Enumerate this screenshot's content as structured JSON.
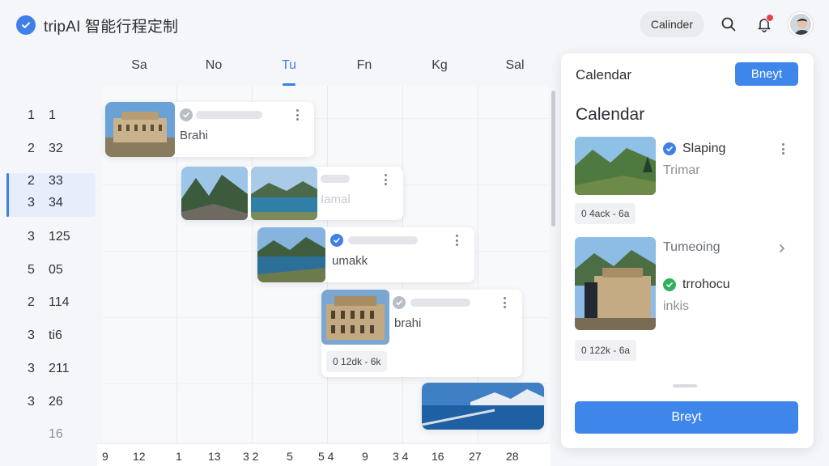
{
  "header": {
    "title": "tripAI 智能行程定制",
    "calendar_button": "Calinder"
  },
  "days": [
    "Sa",
    "No",
    "Tu",
    "Fn",
    "Kg",
    "Sal"
  ],
  "active_day": "Tu",
  "time_rows": [
    {
      "a": "1",
      "b": "1"
    },
    {
      "a": "2",
      "b": "32"
    },
    {
      "a": "2",
      "b": "33"
    },
    {
      "a": "3",
      "b": "34"
    },
    {
      "a": "3",
      "b": "125"
    },
    {
      "a": "5",
      "b": "05"
    },
    {
      "a": "2",
      "b": "114"
    },
    {
      "a": "3",
      "b": "ti6"
    },
    {
      "a": "3",
      "b": "211"
    },
    {
      "a": "3",
      "b": "26"
    },
    {
      "a": "",
      "b": "16"
    }
  ],
  "bottom_ticks": [
    "9",
    "12",
    "1",
    "13",
    "3 2",
    "5",
    "5 4",
    "9",
    "3 4",
    "16",
    "27",
    "28"
  ],
  "events": {
    "e1": {
      "title": "Brahi"
    },
    "e2": {
      "title": "Iamal"
    },
    "e3": {
      "title": "umakk"
    },
    "e4": {
      "title": "brahi",
      "tag": "0 12dk - 6k"
    }
  },
  "panel": {
    "title": "Calendar",
    "top_button": "Bneyt",
    "heading": "Calendar",
    "item1": {
      "title": "Slaping",
      "subtitle": "Trimar",
      "tag": "0 4ack - 6a"
    },
    "item2": {
      "header": "Tumeoing",
      "title": "trrohocu",
      "subtitle": "inkis",
      "tag": "0 122k - 6a"
    },
    "main_button": "Breyt"
  },
  "colors": {
    "accent": "#3f7fe8",
    "button": "#3f86ea",
    "notification": "#e8414b",
    "success": "#30b25a"
  },
  "icons": [
    "check-circle-icon",
    "search-icon",
    "bell-icon",
    "more-vertical-icon",
    "chevron-right-icon"
  ]
}
